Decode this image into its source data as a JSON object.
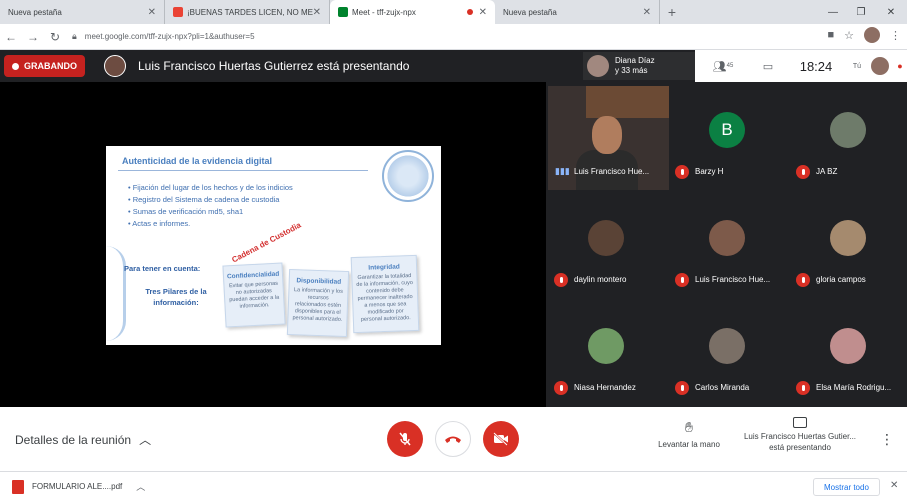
{
  "browser": {
    "tabs": [
      {
        "title": "Nueva pestaña"
      },
      {
        "title": "¡BUENAS TARDES LICEN, NO ME E"
      },
      {
        "title": "Meet - tff-zujx-npx"
      },
      {
        "title": "Nueva pestaña"
      }
    ],
    "url": "meet.google.com/tff-zujx-npx?pli=1&authuser=5"
  },
  "meet": {
    "recording_label": "GRABANDO",
    "presenting_title": "Luis Francisco Huertas Gutierrez está presentando",
    "people_strip": {
      "name": "Diana Díaz",
      "more": "y 33 más"
    },
    "participant_count": "45",
    "clock": "18:24",
    "self_label": "Tú",
    "slide": {
      "title": "Autenticidad de la evidencia digital",
      "bullets": [
        "Fijación del lugar de los hechos y de los indicios",
        "Registro del Sistema de cadena de custodia",
        "Sumas de verificación md5, sha1",
        "Actas e informes."
      ],
      "side_text_1": "Para tener en cuenta:",
      "side_text_2": "Tres Pilares de la información:",
      "stamp": "Cadena de Custodia",
      "cards": [
        {
          "head": "Confidencialidad",
          "body": "Evitar que personas no autorizadas puedan acceder a la información."
        },
        {
          "head": "Disponibilidad",
          "body": "La información y los recursos relacionados estén disponibles para el personal autorizado."
        },
        {
          "head": "Integridad",
          "body": "Garantizar la totalidad de la información, cuyo contenido debe permanecer inalterado a menos que sea modificado por personal autorizado."
        }
      ]
    },
    "participants": [
      {
        "name": "Luis Francisco Hue...",
        "type": "video"
      },
      {
        "name": "Barzy H",
        "type": "letter",
        "letter": "B"
      },
      {
        "name": "JA BZ",
        "type": "photo",
        "color": "#6e7b6a"
      },
      {
        "name": "daylin montero",
        "type": "photo",
        "color": "#5a4336"
      },
      {
        "name": "Luis Francisco Hue...",
        "type": "photo",
        "color": "#7d5a4a"
      },
      {
        "name": "gloria campos",
        "type": "photo",
        "color": "#a58a6e"
      },
      {
        "name": "Niasa Hernandez",
        "type": "photo",
        "color": "#6f9a64"
      },
      {
        "name": "Carlos Miranda",
        "type": "photo",
        "color": "#7a6f66"
      },
      {
        "name": "Elsa María Rodrigu...",
        "type": "photo",
        "color": "#c08e8e"
      }
    ]
  },
  "bottom": {
    "details_label": "Detalles de la reunión",
    "raise_hand_label": "Levantar la mano",
    "presenting_line1": "Luis Francisco Huertas Gutier...",
    "presenting_line2": "está presentando"
  },
  "downloads": {
    "file_name": "FORMULARIO ALE....pdf",
    "show_all": "Mostrar todo"
  },
  "colors": {
    "recording": "#c5221f",
    "danger": "#d93025",
    "link": "#1a73e8",
    "meeting_bg": "#202124"
  }
}
